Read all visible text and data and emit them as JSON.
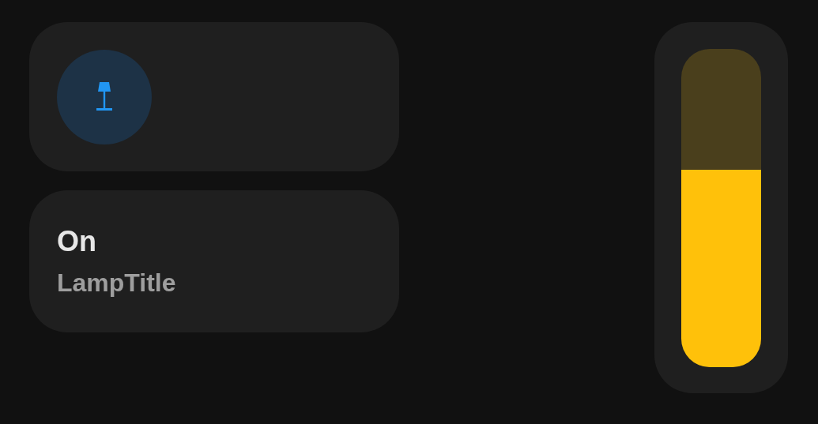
{
  "lamp": {
    "on": true,
    "state": "On",
    "title": "LampTitle"
  },
  "brightness": {
    "level": 0.62
  }
}
